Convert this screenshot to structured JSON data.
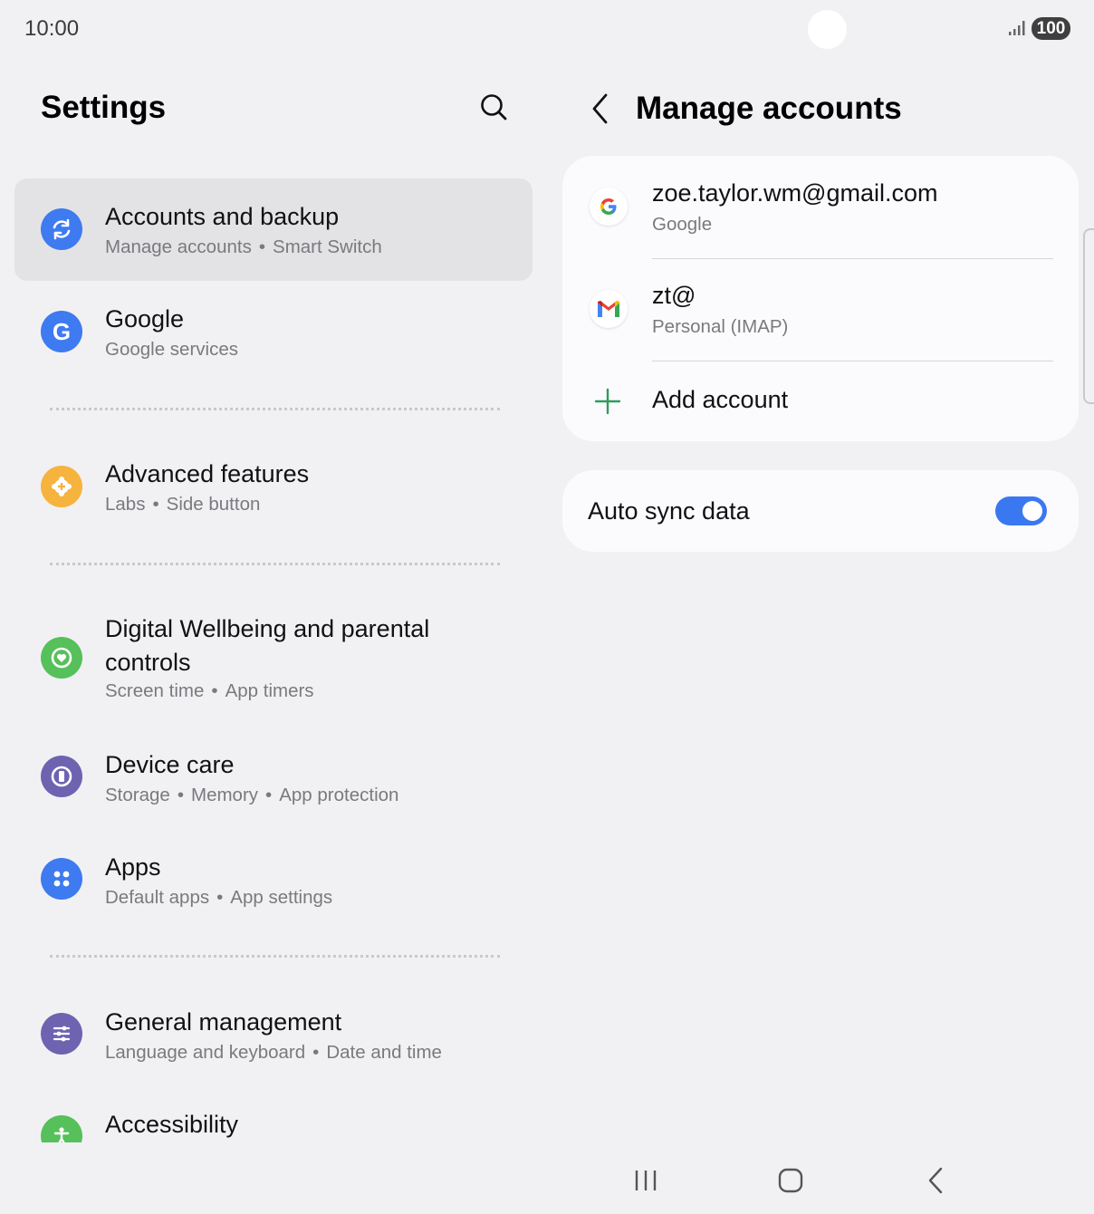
{
  "status_bar": {
    "time": "10:00",
    "battery": "100"
  },
  "left": {
    "title": "Settings",
    "items": [
      {
        "title": "Accounts and backup",
        "sub": [
          "Manage accounts",
          "Smart Switch"
        ],
        "icon": "sync-icon",
        "color": "#3e7af0"
      },
      {
        "title": "Google",
        "sub": [
          "Google services"
        ],
        "icon": "google-g-icon",
        "color": "#3e7af0"
      },
      {
        "title": "Advanced features",
        "sub": [
          "Labs",
          "Side button"
        ],
        "icon": "gear-plus-icon",
        "color": "#f6b33e"
      },
      {
        "title": "Digital Wellbeing and parental controls",
        "sub": [
          "Screen time",
          "App timers"
        ],
        "icon": "heart-circle-icon",
        "color": "#56c05a"
      },
      {
        "title": "Device care",
        "sub": [
          "Storage",
          "Memory",
          "App protection"
        ],
        "icon": "device-care-icon",
        "color": "#6e63b0"
      },
      {
        "title": "Apps",
        "sub": [
          "Default apps",
          "App settings"
        ],
        "icon": "apps-grid-icon",
        "color": "#3e7af0"
      },
      {
        "title": "General management",
        "sub": [
          "Language and keyboard",
          "Date and time"
        ],
        "icon": "sliders-icon",
        "color": "#6e63b0"
      },
      {
        "title": "Accessibility",
        "sub": [],
        "icon": "accessibility-icon",
        "color": "#56c05a"
      }
    ]
  },
  "right": {
    "title": "Manage accounts",
    "accounts": [
      {
        "name": "zoe.taylor.wm@gmail.com",
        "type": "Google",
        "icon": "google-icon"
      },
      {
        "name": "zt@",
        "type": "Personal (IMAP)",
        "icon": "gmail-icon"
      }
    ],
    "add_account": "Add account",
    "auto_sync": {
      "label": "Auto sync data",
      "enabled": true
    }
  },
  "colors": {
    "accent": "#3a78f2",
    "add_green": "#2f9d5a"
  }
}
